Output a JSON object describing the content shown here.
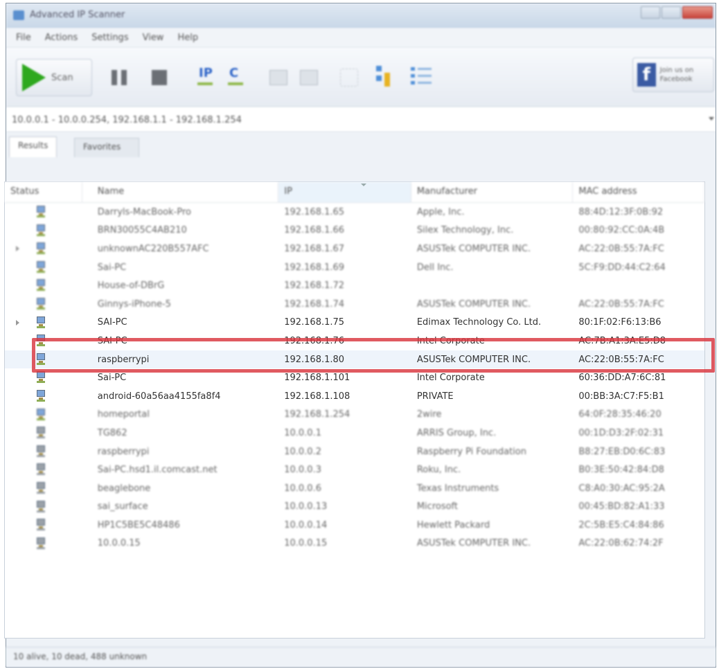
{
  "window": {
    "title": "Advanced IP Scanner"
  },
  "menu": [
    "File",
    "Actions",
    "Settings",
    "View",
    "Help"
  ],
  "toolbar": {
    "scan_label": "Scan",
    "facebook_label": "Join us on Facebook",
    "icons": [
      "play-icon",
      "pause-icon",
      "stop-icon",
      "ip-subnet-icon",
      "c-subnet-icon",
      "expand-icon",
      "collapse-icon",
      "network-icon",
      "tree-icon",
      "list-icon"
    ]
  },
  "address": {
    "value": "10.0.0.1 - 10.0.0.254, 192.168.1.1 - 192.168.1.254"
  },
  "tabs": [
    {
      "label": "Results",
      "active": true
    },
    {
      "label": "Favorites",
      "active": false
    }
  ],
  "table": {
    "columns": [
      "Status",
      "Name",
      "IP",
      "Manufacturer",
      "MAC address"
    ],
    "rows": [
      {
        "status": "alive",
        "expandable": false,
        "name": "Darryls-MacBook-Pro",
        "ip": "192.168.1.65",
        "manufacturer": "Apple, Inc.",
        "mac": "88:4D:12:3F:0B:92"
      },
      {
        "status": "alive",
        "expandable": false,
        "name": "BRN30055C4AB210",
        "ip": "192.168.1.66",
        "manufacturer": "Silex Technology, Inc.",
        "mac": "00:80:92:CC:0A:4B"
      },
      {
        "status": "alive",
        "expandable": true,
        "name": "unknownAC220B557AFC",
        "ip": "192.168.1.67",
        "manufacturer": "ASUSTek COMPUTER INC.",
        "mac": "AC:22:0B:55:7A:FC"
      },
      {
        "status": "alive",
        "expandable": false,
        "name": "Sai-PC",
        "ip": "192.168.1.69",
        "manufacturer": "Dell Inc.",
        "mac": "5C:F9:DD:44:C2:64"
      },
      {
        "status": "alive",
        "expandable": false,
        "name": "House-of-DBrG",
        "ip": "192.168.1.72",
        "manufacturer": "",
        "mac": ""
      },
      {
        "status": "alive",
        "expandable": false,
        "name": "Ginnys-iPhone-5",
        "ip": "192.168.1.74",
        "manufacturer": "ASUSTek COMPUTER INC.",
        "mac": "AC:22:0B:55:7A:FC"
      },
      {
        "status": "alive",
        "expandable": true,
        "name": "SAI-PC",
        "ip": "192.168.1.75",
        "manufacturer": "Edimax Technology Co. Ltd.",
        "mac": "80:1F:02:F6:13:B6"
      },
      {
        "status": "alive",
        "expandable": false,
        "name": "SAI-PC",
        "ip": "192.168.1.76",
        "manufacturer": "Intel Corporate",
        "mac": "AC:7B:A1:3A:E5:D8"
      },
      {
        "status": "alive",
        "expandable": false,
        "name": "raspberrypi",
        "ip": "192.168.1.80",
        "manufacturer": "ASUSTek COMPUTER INC.",
        "mac": "AC:22:0B:55:7A:FC"
      },
      {
        "status": "alive",
        "expandable": false,
        "name": "Sai-PC",
        "ip": "192.168.1.101",
        "manufacturer": "Intel Corporate",
        "mac": "60:36:DD:A7:6C:81"
      },
      {
        "status": "alive",
        "expandable": false,
        "name": "android-60a56aa4155fa8f4",
        "ip": "192.168.1.108",
        "manufacturer": "PRIVATE",
        "mac": "00:BB:3A:C7:F5:B1"
      },
      {
        "status": "alive",
        "expandable": false,
        "name": "homeportal",
        "ip": "192.168.1.254",
        "manufacturer": "2wire",
        "mac": "64:0F:28:35:46:20"
      },
      {
        "status": "dead",
        "expandable": false,
        "name": "TG862",
        "ip": "10.0.0.1",
        "manufacturer": "ARRIS Group, Inc.",
        "mac": "00:1D:D3:2F:02:31"
      },
      {
        "status": "dead",
        "expandable": false,
        "name": "raspberrypi",
        "ip": "10.0.0.2",
        "manufacturer": "Raspberry Pi Foundation",
        "mac": "B8:27:EB:D0:6C:83"
      },
      {
        "status": "dead",
        "expandable": false,
        "name": "Sai-PC.hsd1.il.comcast.net",
        "ip": "10.0.0.3",
        "manufacturer": "Roku, Inc.",
        "mac": "B0:3E:50:42:84:D8"
      },
      {
        "status": "dead",
        "expandable": false,
        "name": "beaglebone",
        "ip": "10.0.0.6",
        "manufacturer": "Texas Instruments",
        "mac": "C8:A0:30:AC:95:2A"
      },
      {
        "status": "dead",
        "expandable": false,
        "name": "sai_surface",
        "ip": "10.0.0.13",
        "manufacturer": "Microsoft",
        "mac": "00:45:BD:82:A1:33"
      },
      {
        "status": "dead",
        "expandable": false,
        "name": "HP1C5BE5C48486",
        "ip": "10.0.0.14",
        "manufacturer": "Hewlett Packard",
        "mac": "2C:5B:E5:C4:84:86"
      },
      {
        "status": "dead",
        "expandable": false,
        "name": "10.0.0.15",
        "ip": "10.0.0.15",
        "manufacturer": "ASUSTek COMPUTER INC.",
        "mac": "AC:22:0B:62:74:2F"
      }
    ]
  },
  "status_bar": {
    "text": "10 alive, 10 dead, 488 unknown"
  },
  "colors": {
    "highlight_border": "#d9363e",
    "scan_green": "#2ea81e",
    "alive_icon": "#7fa6d9"
  }
}
